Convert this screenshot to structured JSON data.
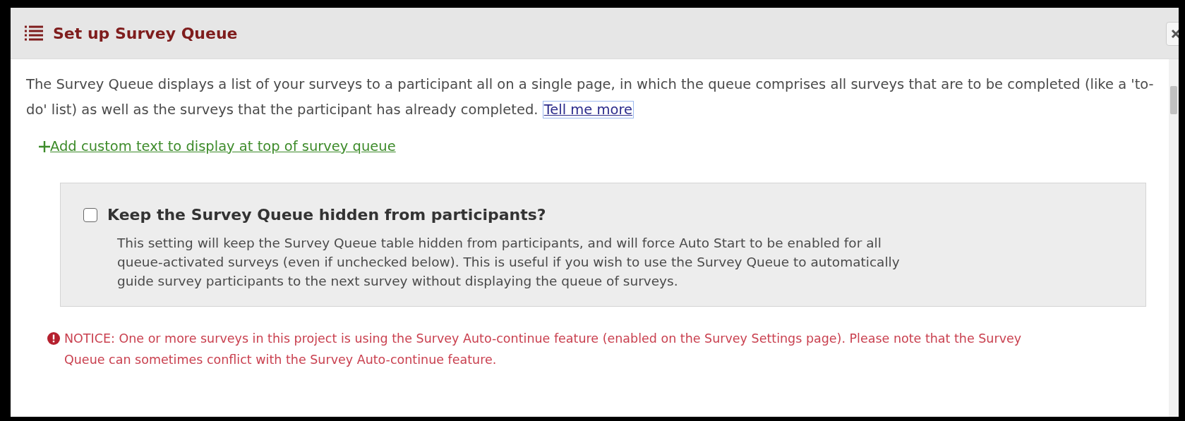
{
  "dialog": {
    "title": "Set up Survey Queue"
  },
  "intro": {
    "text": "The Survey Queue displays a list of your surveys to a participant all on a single page, in which the queue comprises all surveys that are to be completed (like a 'to-do' list) as well as the surveys that the participant has already completed.",
    "link": "Tell me more"
  },
  "add_custom_text": {
    "label": " Add custom text to display at top of survey queue"
  },
  "hide_queue": {
    "label": "Keep the Survey Queue hidden from participants?",
    "checked": false,
    "description": "This setting will keep the Survey Queue table hidden from participants, and will force Auto Start to be enabled for all queue-activated surveys (even if unchecked below). This is useful if you wish to use the Survey Queue to automatically guide survey participants to the next survey without displaying the queue of surveys."
  },
  "notice": {
    "text": "NOTICE: One or more surveys in this project is using the Survey Auto-continue feature (enabled on the Survey Settings page). Please note that the Survey Queue can sometimes conflict with the Survey Auto-continue feature."
  }
}
